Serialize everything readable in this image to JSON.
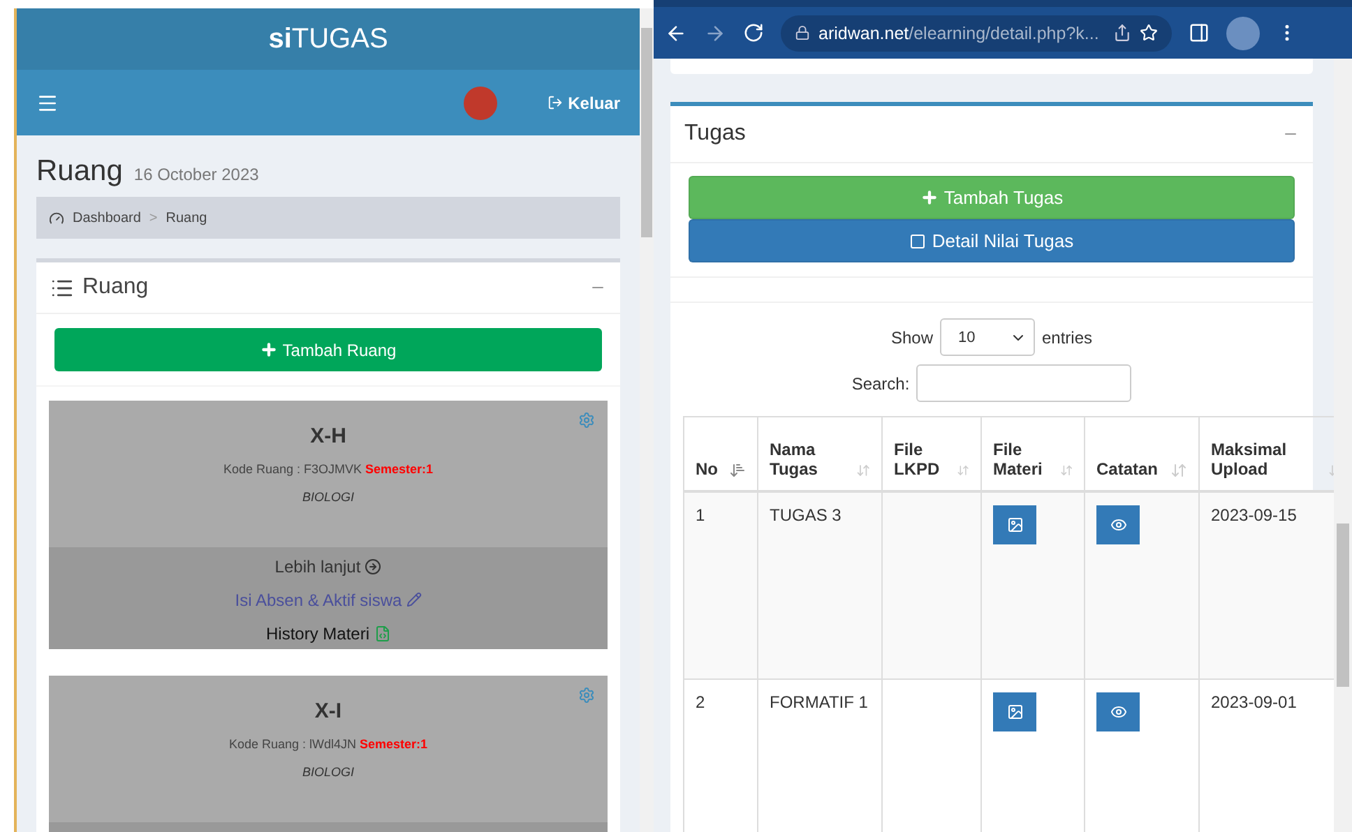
{
  "left": {
    "brand": "**si**TUGAS",
    "logout": "Keluar",
    "page_title": "Ruang",
    "page_date": "16 October 2023",
    "breadcrumb": [
      "Dashboard",
      "Ruang"
    ],
    "breadcrumb_separator": ">",
    "box_title": "Ruang",
    "add_button": "Tambah Ruang",
    "rooms": [
      {
        "name": "X-H",
        "code_label": "Kode Ruang : F3OJMVK",
        "semester": "Semester:1",
        "subject": "BIOLOGI",
        "links": [
          {
            "kind": "next",
            "label": "Lebih lanjut"
          },
          {
            "kind": "edit",
            "label": "Isi Absen & Aktif siswa"
          },
          {
            "kind": "file",
            "label": "History Materi"
          }
        ]
      },
      {
        "name": "X-I",
        "code_label": "Kode Ruang : lWdl4JN",
        "semester": "Semester:1",
        "subject": "BIOLOGI"
      }
    ]
  },
  "right": {
    "url_host": "aridwan.net",
    "url_path": "/elearning/detail.php?k...",
    "box_title": "Tugas",
    "add_button": "Tambah Tugas",
    "detail_button": "Detail Nilai Tugas",
    "show_label": "Show",
    "page_size": "10",
    "entries_label": "entries",
    "search_label": "Search:",
    "columns": [
      {
        "label": "No",
        "sorted": true
      },
      {
        "label": "Nama Tugas",
        "sorted": false
      },
      {
        "label": "File LKPD",
        "sorted": false
      },
      {
        "label": "File Materi",
        "sorted": false
      },
      {
        "label": "Catatan",
        "sorted": false
      },
      {
        "label": "Maksimal Upload",
        "sorted": false
      }
    ],
    "rows": [
      {
        "no": "1",
        "name": "TUGAS 3",
        "deadline": "2023-09-15"
      },
      {
        "no": "2",
        "name": "FORMATIF 1",
        "deadline": "2023-09-01"
      }
    ]
  }
}
